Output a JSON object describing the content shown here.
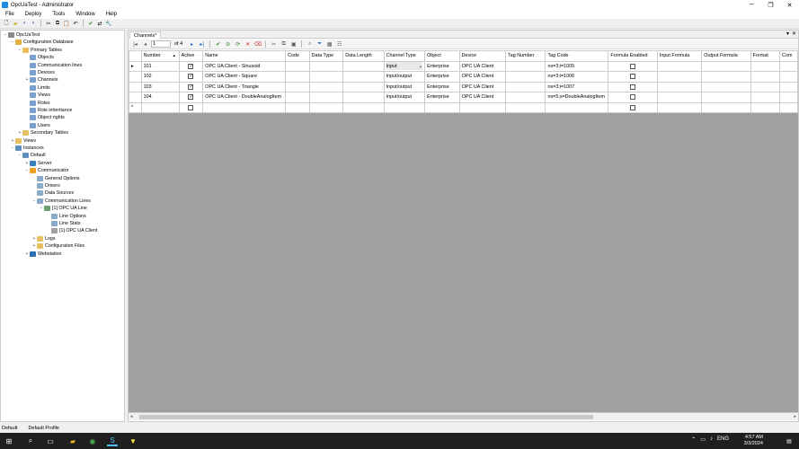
{
  "window": {
    "title": "OpcUaTest - Administrator"
  },
  "menu": [
    "File",
    "Deploy",
    "Tools",
    "Window",
    "Help"
  ],
  "tree": [
    {
      "label": "OpcUaTest",
      "indent": 0,
      "exp": "−",
      "icon": "#888888"
    },
    {
      "label": "Configuration Database",
      "indent": 1,
      "exp": "−",
      "icon": "#e0b040"
    },
    {
      "label": "Primary Tables",
      "indent": 2,
      "exp": "−",
      "icon": "#e8c060"
    },
    {
      "label": "Objects",
      "indent": 3,
      "exp": "",
      "icon": "#7aa0d0"
    },
    {
      "label": "Communication lines",
      "indent": 3,
      "exp": "",
      "icon": "#7aa0d0"
    },
    {
      "label": "Devices",
      "indent": 3,
      "exp": "",
      "icon": "#7aa0d0"
    },
    {
      "label": "Channels",
      "indent": 3,
      "exp": "+",
      "icon": "#7aa0d0"
    },
    {
      "label": "Limits",
      "indent": 3,
      "exp": "",
      "icon": "#7aa0d0"
    },
    {
      "label": "Views",
      "indent": 3,
      "exp": "",
      "icon": "#7aa0d0"
    },
    {
      "label": "Roles",
      "indent": 3,
      "exp": "",
      "icon": "#7aa0d0"
    },
    {
      "label": "Role inheritance",
      "indent": 3,
      "exp": "",
      "icon": "#7aa0d0"
    },
    {
      "label": "Object rights",
      "indent": 3,
      "exp": "",
      "icon": "#7aa0d0"
    },
    {
      "label": "Users",
      "indent": 3,
      "exp": "",
      "icon": "#7aa0d0"
    },
    {
      "label": "Secondary Tables",
      "indent": 2,
      "exp": "+",
      "icon": "#e8c060"
    },
    {
      "label": "Views",
      "indent": 1,
      "exp": "+",
      "icon": "#e8c060"
    },
    {
      "label": "Instances",
      "indent": 1,
      "exp": "−",
      "icon": "#6090c0"
    },
    {
      "label": "Default",
      "indent": 2,
      "exp": "−",
      "icon": "#6090c0"
    },
    {
      "label": "Server",
      "indent": 3,
      "exp": "+",
      "icon": "#3a7fc0"
    },
    {
      "label": "Communicator",
      "indent": 3,
      "exp": "−",
      "icon": "#f0a020"
    },
    {
      "label": "General Options",
      "indent": 4,
      "exp": "",
      "icon": "#8aa8c8"
    },
    {
      "label": "Drivers",
      "indent": 4,
      "exp": "",
      "icon": "#8aa8c8"
    },
    {
      "label": "Data Sources",
      "indent": 4,
      "exp": "",
      "icon": "#8aa8c8"
    },
    {
      "label": "Communication Lines",
      "indent": 4,
      "exp": "−",
      "icon": "#8aa8c8"
    },
    {
      "label": "[1] OPC UA Line",
      "indent": 5,
      "exp": "−",
      "icon": "#70a070"
    },
    {
      "label": "Line Options",
      "indent": 6,
      "exp": "",
      "icon": "#8aa8c8"
    },
    {
      "label": "Line Stats",
      "indent": 6,
      "exp": "",
      "icon": "#8aa8c8"
    },
    {
      "label": "[1] OPC UA Client",
      "indent": 6,
      "exp": "",
      "icon": "#a0a0a0"
    },
    {
      "label": "Logs",
      "indent": 4,
      "exp": "+",
      "icon": "#e8c060"
    },
    {
      "label": "Configuration Files",
      "indent": 4,
      "exp": "+",
      "icon": "#e8c060"
    },
    {
      "label": "Webstation",
      "indent": 3,
      "exp": "+",
      "icon": "#2a6fb0"
    }
  ],
  "doc_tab": "Channels*",
  "nav": {
    "position": "1",
    "of": "of 4"
  },
  "columns": [
    "",
    "Number",
    "Active",
    "Name",
    "Code",
    "Data Type",
    "Data Length",
    "Channel Type",
    "Object",
    "Device",
    "Tag Number",
    "Tag Code",
    "Formula Enabled",
    "Input Formula",
    "Output Formula",
    "Format",
    "Com"
  ],
  "rows": [
    {
      "marker": "▸",
      "number": "101",
      "active": true,
      "name": "OPC UA Client - Sinusoid",
      "code": "",
      "data_type": "",
      "data_length": "",
      "channel_type": "Input",
      "object": "Enterprise",
      "device": "OPC UA Client",
      "tag_number": "",
      "tag_code": "ns=3;i=1005",
      "formula_enabled": false
    },
    {
      "marker": "",
      "number": "102",
      "active": true,
      "name": "OPC UA Client - Square",
      "code": "",
      "data_type": "",
      "data_length": "",
      "channel_type": "Input/output",
      "object": "Enterprise",
      "device": "OPC UA Client",
      "tag_number": "",
      "tag_code": "ns=3;i=1006",
      "formula_enabled": false
    },
    {
      "marker": "",
      "number": "103",
      "active": true,
      "name": "OPC UA Client - Triangle",
      "code": "",
      "data_type": "",
      "data_length": "",
      "channel_type": "Input/output",
      "object": "Enterprise",
      "device": "OPC UA Client",
      "tag_number": "",
      "tag_code": "ns=3;i=1007",
      "formula_enabled": false
    },
    {
      "marker": "",
      "number": "104",
      "active": true,
      "name": "OPC UA Client - DoubleAnalogItem",
      "code": "",
      "data_type": "",
      "data_length": "",
      "channel_type": "Input/output",
      "object": "Enterprise",
      "device": "OPC UA Client",
      "tag_number": "",
      "tag_code": "ns=5;s=DoubleAnalogItem",
      "formula_enabled": false
    }
  ],
  "new_row_marker": "*",
  "status": {
    "left": "Default",
    "profile": "Default Profile"
  },
  "clock": {
    "time": "4:57 AM",
    "date": "3/3/2024"
  },
  "tray": {
    "lang": "ENG"
  }
}
